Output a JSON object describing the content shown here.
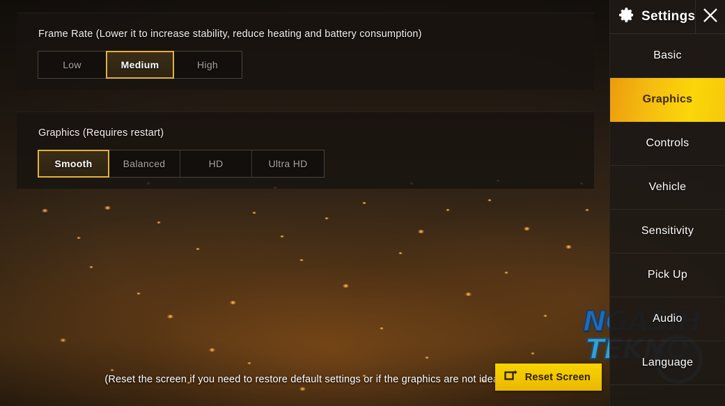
{
  "window": {
    "title": "Settings",
    "accent_yellow": "#f5c40a",
    "selected_border": "#e2b33c",
    "background_tone": "#3a2a18"
  },
  "header": {
    "title": "Settings",
    "gear_icon": "gear-icon",
    "close_icon": "close-icon"
  },
  "settings_groups": [
    {
      "id": "frame_rate",
      "label": "Frame Rate (Lower it to increase stability, reduce heating and battery consumption)",
      "options": [
        "Low",
        "Medium",
        "High"
      ],
      "selected": "Medium",
      "selected_index": 1
    },
    {
      "id": "graphics",
      "label": "Graphics (Requires restart)",
      "options": [
        "Smooth",
        "Balanced",
        "HD",
        "Ultra HD"
      ],
      "selected": "Smooth",
      "selected_index": 0
    }
  ],
  "sidebar": {
    "items": [
      {
        "label": "Basic",
        "active": false
      },
      {
        "label": "Graphics",
        "active": true
      },
      {
        "label": "Controls",
        "active": false
      },
      {
        "label": "Vehicle",
        "active": false
      },
      {
        "label": "Sensitivity",
        "active": false
      },
      {
        "label": "Pick Up",
        "active": false
      },
      {
        "label": "Audio",
        "active": false
      },
      {
        "label": "Language",
        "active": false
      }
    ]
  },
  "footer": {
    "hint": "(Reset the screen if you need to restore default settings or if the graphics are not ideal)",
    "reset_button": {
      "label": "Reset Screen",
      "icon": "screen-reset-icon"
    }
  },
  "watermark": {
    "line1": "NGASIH",
    "line2": "TEKNO"
  }
}
